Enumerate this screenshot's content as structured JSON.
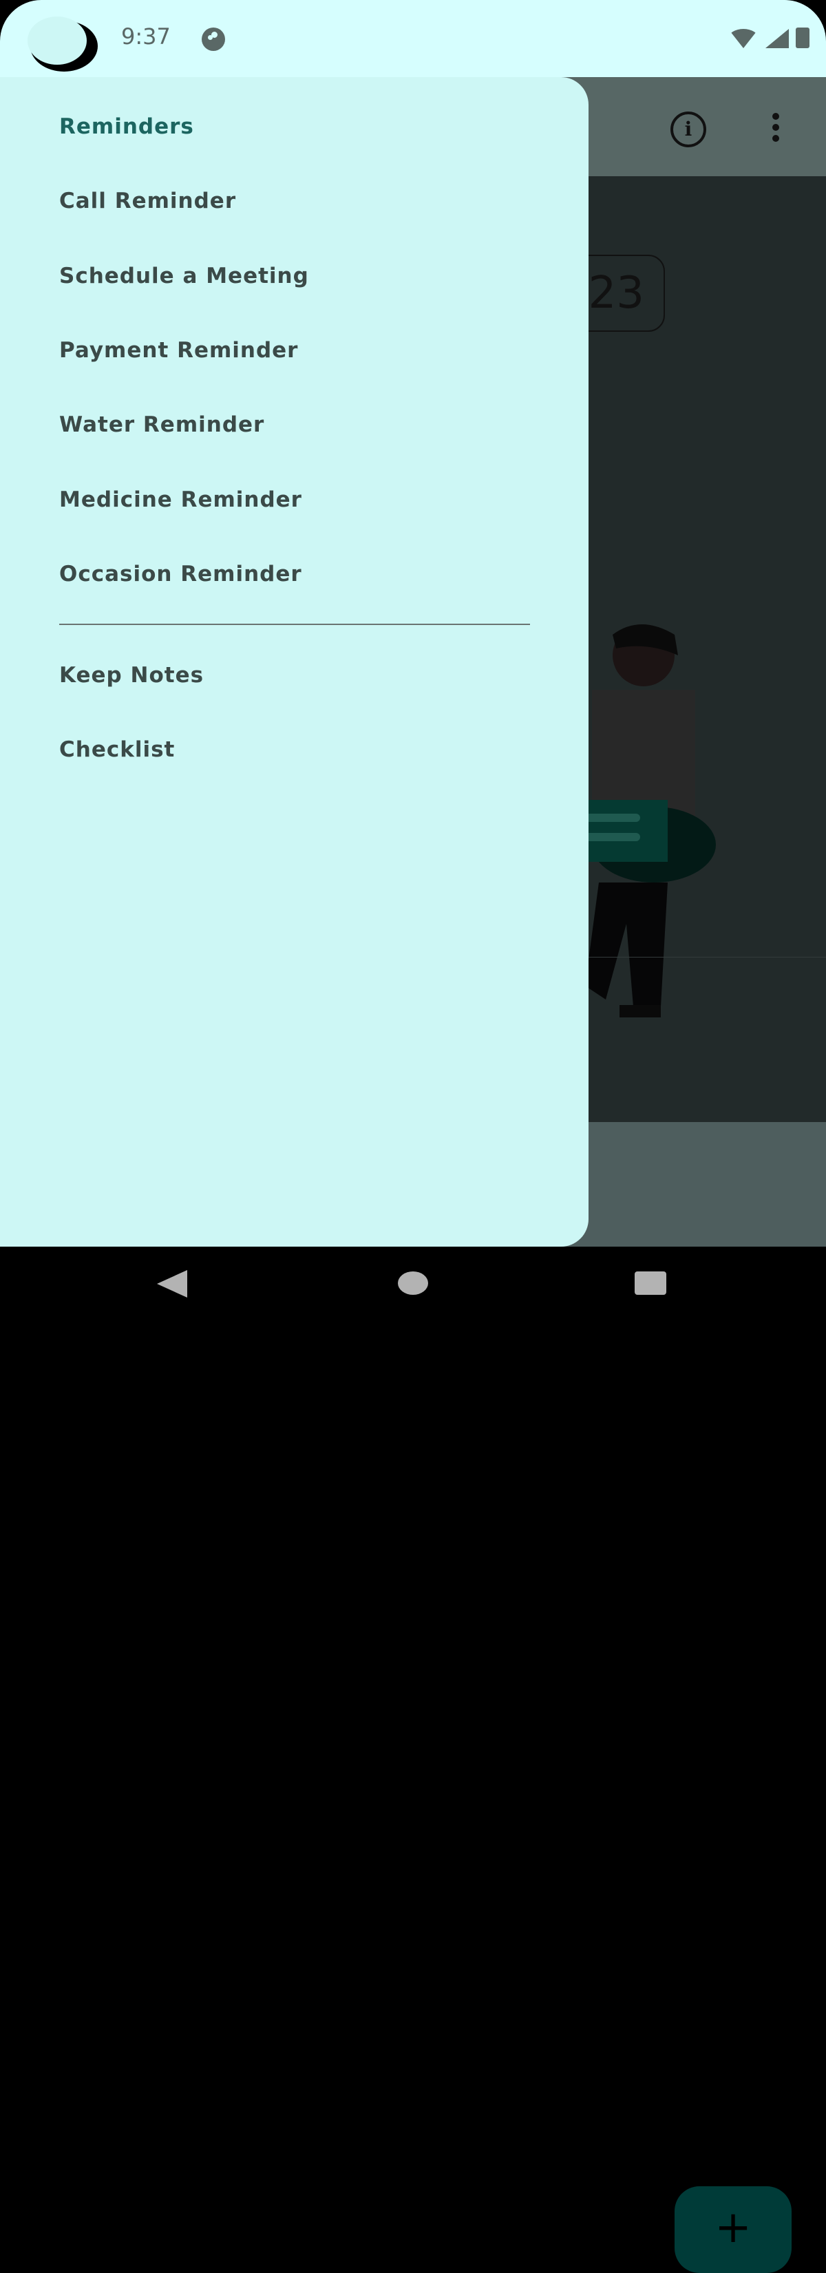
{
  "status_bar": {
    "time": "9:37",
    "icons": [
      "notification-icon",
      "wifi-icon",
      "signal-icon",
      "battery-icon"
    ]
  },
  "app_bar": {
    "icons": [
      "info-icon",
      "more-vert-icon"
    ],
    "info_glyph": "i"
  },
  "background": {
    "date_fragment": "23",
    "fab_label": "+"
  },
  "drawer": {
    "items": [
      {
        "label": "Reminders",
        "active": true
      },
      {
        "label": "Call Reminder"
      },
      {
        "label": "Schedule a Meeting"
      },
      {
        "label": "Payment Reminder"
      },
      {
        "label": "Water Reminder"
      },
      {
        "label": "Medicine Reminder"
      },
      {
        "label": "Occasion Reminder"
      }
    ],
    "secondary_items": [
      {
        "label": "Keep Notes"
      },
      {
        "label": "Checklist"
      }
    ]
  },
  "colors": {
    "drawer_bg": "#cdf7f5",
    "accent": "#1c6560",
    "fab": "#003b38",
    "scrim": "#222a2a"
  }
}
